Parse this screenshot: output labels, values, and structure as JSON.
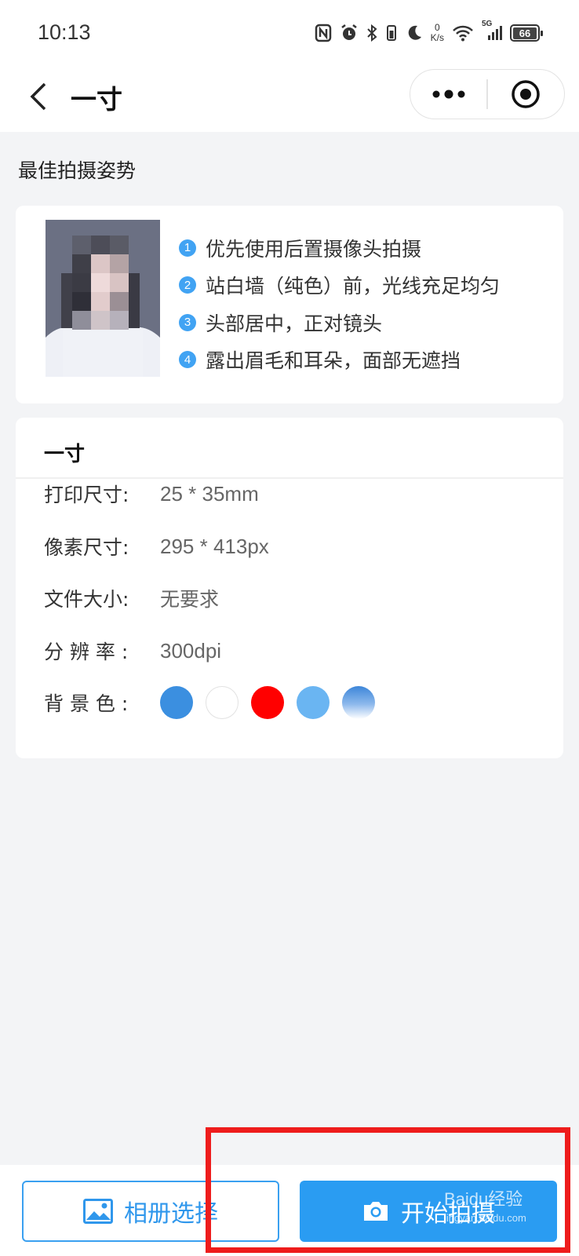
{
  "status_bar": {
    "time": "10:13",
    "net_speed_value": "0",
    "net_speed_unit": "K/s",
    "network_type": "5G",
    "battery_level": "66",
    "icons": [
      "nfc-icon",
      "alarm-icon",
      "bluetooth-icon",
      "vibrate-icon",
      "moon-icon",
      "wifi-icon",
      "signal-icon",
      "battery-icon"
    ]
  },
  "nav": {
    "title": "一寸",
    "icons": [
      "back-arrow-icon",
      "more-dots-icon",
      "target-icon"
    ]
  },
  "pose_section": {
    "heading": "最佳拍摄姿势",
    "tips": [
      {
        "num": "1",
        "text": "优先使用后置摄像头拍摄"
      },
      {
        "num": "2",
        "text": "站白墙（纯色）前，光线充足均匀"
      },
      {
        "num": "3",
        "text": "头部居中，正对镜头"
      },
      {
        "num": "4",
        "text": "露出眉毛和耳朵，面部无遮挡"
      }
    ]
  },
  "spec": {
    "title": "一寸",
    "print_size_label": "打印尺寸:",
    "print_size_value": "25 * 35mm",
    "pixel_size_label": "像素尺寸:",
    "pixel_size_value": "295 * 413px",
    "file_size_label": "文件大小:",
    "file_size_value": "无要求",
    "resolution_label": "分 辨 率 :",
    "resolution_value": "300dpi",
    "bg_color_label": "背 景 色 :",
    "bg_colors": [
      "#3b8fe0",
      "#ffffff",
      "#ff0000",
      "#6ab5f2",
      "gradient-blue-white"
    ]
  },
  "actions": {
    "album_label": "相册选择",
    "shoot_label": "开始拍摄"
  },
  "watermark": {
    "text": "Baidu经验",
    "url": "jingyan.baidu.com"
  },
  "colors": {
    "accent": "#2a9cf2",
    "highlight": "#ee1c1c",
    "background": "#f3f4f6"
  }
}
